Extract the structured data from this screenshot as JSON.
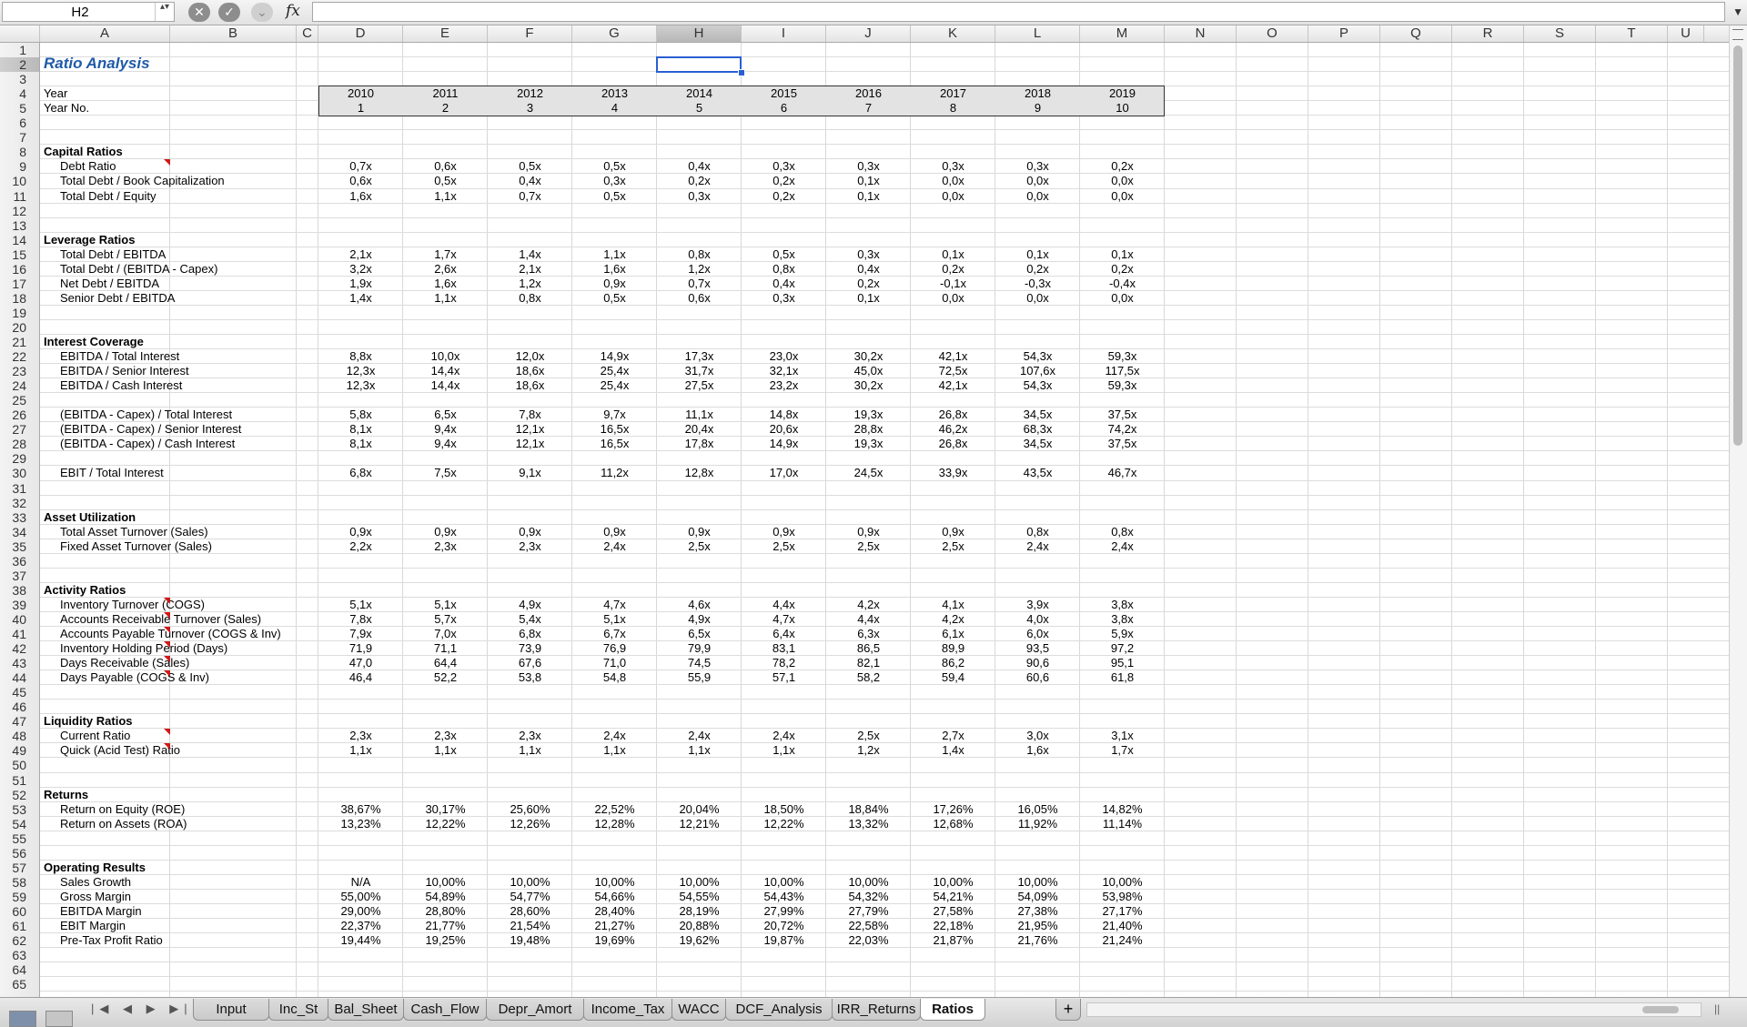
{
  "formula_bar": {
    "cell_ref": "H2",
    "stepper": "▴▾",
    "cancel_glyph": "✕",
    "confirm_glyph": "✓",
    "function_glyph": "⌄",
    "fx": "fx",
    "formula": "",
    "expand_glyph": "▼"
  },
  "columns": [
    "A",
    "B",
    "C",
    "D",
    "E",
    "F",
    "G",
    "H",
    "I",
    "J",
    "K",
    "L",
    "M",
    "N",
    "O",
    "P",
    "Q",
    "R",
    "S",
    "T",
    "U"
  ],
  "selected_column": "H",
  "rows": [
    "1",
    "2",
    "3",
    "4",
    "5",
    "6",
    "7",
    "8",
    "9",
    "10",
    "11",
    "12",
    "13",
    "14",
    "15",
    "16",
    "17",
    "18",
    "19",
    "20",
    "21",
    "22",
    "23",
    "24",
    "25",
    "26",
    "27",
    "28",
    "29",
    "30",
    "31",
    "32",
    "33",
    "34",
    "35",
    "36",
    "37",
    "38",
    "39",
    "40",
    "41",
    "42",
    "43",
    "44",
    "45",
    "46",
    "47",
    "48",
    "49",
    "50",
    "51",
    "52",
    "53",
    "54",
    "55",
    "56",
    "57",
    "58",
    "59",
    "60",
    "61",
    "62",
    "63",
    "64",
    "65"
  ],
  "selected_row": "2",
  "sheet": {
    "title": "Ratio Analysis",
    "year_label": "Year",
    "year_no_label": "Year No.",
    "years": [
      "2010",
      "2011",
      "2012",
      "2013",
      "2014",
      "2015",
      "2016",
      "2017",
      "2018",
      "2019"
    ],
    "year_nos": [
      "1",
      "2",
      "3",
      "4",
      "5",
      "6",
      "7",
      "8",
      "9",
      "10"
    ],
    "lines": [
      {
        "row": 8,
        "type": "section",
        "label": "Capital Ratios"
      },
      {
        "row": 9,
        "label": "Debt Ratio",
        "values": [
          "0,7x",
          "0,6x",
          "0,5x",
          "0,5x",
          "0,4x",
          "0,3x",
          "0,3x",
          "0,3x",
          "0,3x",
          "0,2x"
        ]
      },
      {
        "row": 10,
        "label": "Total Debt / Book Capitalization",
        "values": [
          "0,6x",
          "0,5x",
          "0,4x",
          "0,3x",
          "0,2x",
          "0,2x",
          "0,1x",
          "0,0x",
          "0,0x",
          "0,0x"
        ]
      },
      {
        "row": 11,
        "label": "Total Debt / Equity",
        "values": [
          "1,6x",
          "1,1x",
          "0,7x",
          "0,5x",
          "0,3x",
          "0,2x",
          "0,1x",
          "0,0x",
          "0,0x",
          "0,0x"
        ]
      },
      {
        "row": 14,
        "type": "section",
        "label": "Leverage Ratios"
      },
      {
        "row": 15,
        "label": "Total Debt / EBITDA",
        "values": [
          "2,1x",
          "1,7x",
          "1,4x",
          "1,1x",
          "0,8x",
          "0,5x",
          "0,3x",
          "0,1x",
          "0,1x",
          "0,1x"
        ]
      },
      {
        "row": 16,
        "label": "Total Debt / (EBITDA - Capex)",
        "values": [
          "3,2x",
          "2,6x",
          "2,1x",
          "1,6x",
          "1,2x",
          "0,8x",
          "0,4x",
          "0,2x",
          "0,2x",
          "0,2x"
        ]
      },
      {
        "row": 17,
        "label": "Net Debt / EBITDA",
        "values": [
          "1,9x",
          "1,6x",
          "1,2x",
          "0,9x",
          "0,7x",
          "0,4x",
          "0,2x",
          "-0,1x",
          "-0,3x",
          "-0,4x"
        ]
      },
      {
        "row": 18,
        "label": "Senior Debt / EBITDA",
        "values": [
          "1,4x",
          "1,1x",
          "0,8x",
          "0,5x",
          "0,6x",
          "0,3x",
          "0,1x",
          "0,0x",
          "0,0x",
          "0,0x"
        ]
      },
      {
        "row": 21,
        "type": "section",
        "label": "Interest Coverage"
      },
      {
        "row": 22,
        "label": "EBITDA / Total Interest",
        "values": [
          "8,8x",
          "10,0x",
          "12,0x",
          "14,9x",
          "17,3x",
          "23,0x",
          "30,2x",
          "42,1x",
          "54,3x",
          "59,3x"
        ]
      },
      {
        "row": 23,
        "label": "EBITDA / Senior Interest",
        "values": [
          "12,3x",
          "14,4x",
          "18,6x",
          "25,4x",
          "31,7x",
          "32,1x",
          "45,0x",
          "72,5x",
          "107,6x",
          "117,5x"
        ]
      },
      {
        "row": 24,
        "label": "EBITDA / Cash Interest",
        "values": [
          "12,3x",
          "14,4x",
          "18,6x",
          "25,4x",
          "27,5x",
          "23,2x",
          "30,2x",
          "42,1x",
          "54,3x",
          "59,3x"
        ]
      },
      {
        "row": 26,
        "label": "(EBITDA - Capex) / Total Interest",
        "values": [
          "5,8x",
          "6,5x",
          "7,8x",
          "9,7x",
          "11,1x",
          "14,8x",
          "19,3x",
          "26,8x",
          "34,5x",
          "37,5x"
        ]
      },
      {
        "row": 27,
        "label": "(EBITDA - Capex) / Senior Interest",
        "values": [
          "8,1x",
          "9,4x",
          "12,1x",
          "16,5x",
          "20,4x",
          "20,6x",
          "28,8x",
          "46,2x",
          "68,3x",
          "74,2x"
        ]
      },
      {
        "row": 28,
        "label": "(EBITDA - Capex) / Cash Interest",
        "values": [
          "8,1x",
          "9,4x",
          "12,1x",
          "16,5x",
          "17,8x",
          "14,9x",
          "19,3x",
          "26,8x",
          "34,5x",
          "37,5x"
        ]
      },
      {
        "row": 30,
        "label": "EBIT / Total Interest",
        "values": [
          "6,8x",
          "7,5x",
          "9,1x",
          "11,2x",
          "12,8x",
          "17,0x",
          "24,5x",
          "33,9x",
          "43,5x",
          "46,7x"
        ]
      },
      {
        "row": 33,
        "type": "section",
        "label": "Asset Utilization"
      },
      {
        "row": 34,
        "label": "Total Asset Turnover (Sales)",
        "values": [
          "0,9x",
          "0,9x",
          "0,9x",
          "0,9x",
          "0,9x",
          "0,9x",
          "0,9x",
          "0,9x",
          "0,8x",
          "0,8x"
        ]
      },
      {
        "row": 35,
        "label": "Fixed Asset Turnover (Sales)",
        "values": [
          "2,2x",
          "2,3x",
          "2,3x",
          "2,4x",
          "2,5x",
          "2,5x",
          "2,5x",
          "2,5x",
          "2,4x",
          "2,4x"
        ]
      },
      {
        "row": 38,
        "type": "section",
        "label": "Activity Ratios"
      },
      {
        "row": 39,
        "label": "Inventory Turnover (COGS)",
        "values": [
          "5,1x",
          "5,1x",
          "4,9x",
          "4,7x",
          "4,6x",
          "4,4x",
          "4,2x",
          "4,1x",
          "3,9x",
          "3,8x"
        ]
      },
      {
        "row": 40,
        "label": "Accounts Receivable Turnover (Sales)",
        "values": [
          "7,8x",
          "5,7x",
          "5,4x",
          "5,1x",
          "4,9x",
          "4,7x",
          "4,4x",
          "4,2x",
          "4,0x",
          "3,8x"
        ]
      },
      {
        "row": 41,
        "label": "Accounts Payable Turnover (COGS & Inv)",
        "values": [
          "7,9x",
          "7,0x",
          "6,8x",
          "6,7x",
          "6,5x",
          "6,4x",
          "6,3x",
          "6,1x",
          "6,0x",
          "5,9x"
        ]
      },
      {
        "row": 42,
        "label": "Inventory Holding Period (Days)",
        "values": [
          "71,9",
          "71,1",
          "73,9",
          "76,9",
          "79,9",
          "83,1",
          "86,5",
          "89,9",
          "93,5",
          "97,2"
        ]
      },
      {
        "row": 43,
        "label": "Days Receivable (Sales)",
        "values": [
          "47,0",
          "64,4",
          "67,6",
          "71,0",
          "74,5",
          "78,2",
          "82,1",
          "86,2",
          "90,6",
          "95,1"
        ]
      },
      {
        "row": 44,
        "label": "Days Payable (COGS & Inv)",
        "values": [
          "46,4",
          "52,2",
          "53,8",
          "54,8",
          "55,9",
          "57,1",
          "58,2",
          "59,4",
          "60,6",
          "61,8"
        ]
      },
      {
        "row": 47,
        "type": "section",
        "label": "Liquidity Ratios"
      },
      {
        "row": 48,
        "label": "Current Ratio",
        "values": [
          "2,3x",
          "2,3x",
          "2,3x",
          "2,4x",
          "2,4x",
          "2,4x",
          "2,5x",
          "2,7x",
          "3,0x",
          "3,1x"
        ]
      },
      {
        "row": 49,
        "label": "Quick (Acid Test) Ratio",
        "values": [
          "1,1x",
          "1,1x",
          "1,1x",
          "1,1x",
          "1,1x",
          "1,1x",
          "1,2x",
          "1,4x",
          "1,6x",
          "1,7x"
        ]
      },
      {
        "row": 52,
        "type": "section",
        "label": "Returns"
      },
      {
        "row": 53,
        "label": "Return on Equity (ROE)",
        "values": [
          "38,67%",
          "30,17%",
          "25,60%",
          "22,52%",
          "20,04%",
          "18,50%",
          "18,84%",
          "17,26%",
          "16,05%",
          "14,82%"
        ]
      },
      {
        "row": 54,
        "label": "Return on Assets (ROA)",
        "values": [
          "13,23%",
          "12,22%",
          "12,26%",
          "12,28%",
          "12,21%",
          "12,22%",
          "13,32%",
          "12,68%",
          "11,92%",
          "11,14%"
        ]
      },
      {
        "row": 57,
        "type": "section",
        "label": "Operating Results"
      },
      {
        "row": 58,
        "label": "Sales Growth",
        "values": [
          "N/A",
          "10,00%",
          "10,00%",
          "10,00%",
          "10,00%",
          "10,00%",
          "10,00%",
          "10,00%",
          "10,00%",
          "10,00%"
        ]
      },
      {
        "row": 59,
        "label": "Gross Margin",
        "values": [
          "55,00%",
          "54,89%",
          "54,77%",
          "54,66%",
          "54,55%",
          "54,43%",
          "54,32%",
          "54,21%",
          "54,09%",
          "53,98%"
        ]
      },
      {
        "row": 60,
        "label": "EBITDA Margin",
        "values": [
          "29,00%",
          "28,80%",
          "28,60%",
          "28,40%",
          "28,19%",
          "27,99%",
          "27,79%",
          "27,58%",
          "27,38%",
          "27,17%"
        ]
      },
      {
        "row": 61,
        "label": "EBIT Margin",
        "values": [
          "22,37%",
          "21,77%",
          "21,54%",
          "21,27%",
          "20,88%",
          "20,72%",
          "22,58%",
          "22,18%",
          "21,95%",
          "21,40%"
        ]
      },
      {
        "row": 62,
        "label": "Pre-Tax Profit Ratio",
        "values": [
          "19,44%",
          "19,25%",
          "19,48%",
          "19,69%",
          "19,62%",
          "19,87%",
          "22,03%",
          "21,87%",
          "21,76%",
          "21,24%"
        ]
      }
    ]
  },
  "comment_marker_rows": [
    9,
    39,
    40,
    41,
    42,
    43,
    44,
    48,
    49
  ],
  "tabs": {
    "nav_glyphs": "|◀ ◀ ▶ ▶|",
    "items": [
      "Input",
      "Inc_St",
      "Bal_Sheet",
      "Cash_Flow",
      "Depr_Amort",
      "Income_Tax",
      "WACC",
      "DCF_Analysis",
      "IRR_Returns",
      "Ratios"
    ],
    "active": "Ratios",
    "add_label": "+"
  },
  "colors": {
    "title": "#1f5aa8",
    "selection": "#2a5fd3",
    "comment_marker": "#d01818"
  }
}
